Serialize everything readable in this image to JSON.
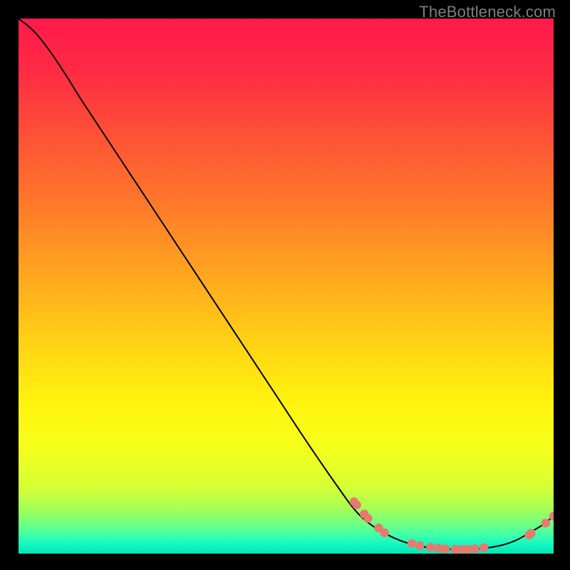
{
  "watermark": "TheBottleneck.com",
  "colors": {
    "line": "#000000",
    "dot": "#e77a6f",
    "background_black": "#000000"
  },
  "chart_data": {
    "type": "line",
    "title": "",
    "xlabel": "",
    "ylabel": "",
    "xlim": [
      0,
      100
    ],
    "ylim": [
      0,
      100
    ],
    "annotations": [],
    "curve": [
      {
        "x": 0.0,
        "y": 100.0
      },
      {
        "x": 3.0,
        "y": 97.5
      },
      {
        "x": 6.0,
        "y": 93.7
      },
      {
        "x": 9.0,
        "y": 89.2
      },
      {
        "x": 12.0,
        "y": 84.4
      },
      {
        "x": 18.0,
        "y": 75.3
      },
      {
        "x": 24.0,
        "y": 66.2
      },
      {
        "x": 30.0,
        "y": 57.1
      },
      {
        "x": 36.0,
        "y": 48.0
      },
      {
        "x": 42.0,
        "y": 38.9
      },
      {
        "x": 48.0,
        "y": 29.8
      },
      {
        "x": 54.0,
        "y": 20.7
      },
      {
        "x": 60.0,
        "y": 12.0
      },
      {
        "x": 63.0,
        "y": 8.0
      },
      {
        "x": 66.0,
        "y": 5.3
      },
      {
        "x": 70.0,
        "y": 3.0
      },
      {
        "x": 74.0,
        "y": 1.6
      },
      {
        "x": 78.0,
        "y": 1.0
      },
      {
        "x": 82.0,
        "y": 0.8
      },
      {
        "x": 86.0,
        "y": 0.9
      },
      {
        "x": 90.0,
        "y": 1.5
      },
      {
        "x": 93.0,
        "y": 2.5
      },
      {
        "x": 96.0,
        "y": 4.2
      },
      {
        "x": 98.0,
        "y": 5.4
      },
      {
        "x": 100.0,
        "y": 7.0
      }
    ],
    "points": [
      {
        "x": 62.7,
        "y": 9.7
      },
      {
        "x": 63.2,
        "y": 9.1
      },
      {
        "x": 64.6,
        "y": 7.4
      },
      {
        "x": 65.3,
        "y": 6.6
      },
      {
        "x": 67.3,
        "y": 4.8
      },
      {
        "x": 68.4,
        "y": 3.9
      },
      {
        "x": 73.5,
        "y": 1.9
      },
      {
        "x": 75.0,
        "y": 1.5
      },
      {
        "x": 77.0,
        "y": 1.2
      },
      {
        "x": 78.5,
        "y": 1.0
      },
      {
        "x": 79.8,
        "y": 0.9
      },
      {
        "x": 81.6,
        "y": 0.8
      },
      {
        "x": 82.0,
        "y": 0.8
      },
      {
        "x": 83.2,
        "y": 0.8
      },
      {
        "x": 84.0,
        "y": 0.8
      },
      {
        "x": 85.3,
        "y": 0.9
      },
      {
        "x": 87.0,
        "y": 1.1
      },
      {
        "x": 95.4,
        "y": 3.5
      },
      {
        "x": 95.8,
        "y": 3.8
      },
      {
        "x": 98.5,
        "y": 5.7
      },
      {
        "x": 100.0,
        "y": 7.0
      }
    ],
    "gradient_stops": [
      {
        "offset": 0.0,
        "color": "#ff1a4b"
      },
      {
        "offset": 0.1,
        "color": "#ff2b44"
      },
      {
        "offset": 0.22,
        "color": "#ff5236"
      },
      {
        "offset": 0.35,
        "color": "#ff7a2a"
      },
      {
        "offset": 0.48,
        "color": "#ffa61f"
      },
      {
        "offset": 0.6,
        "color": "#ffd015"
      },
      {
        "offset": 0.72,
        "color": "#fff40e"
      },
      {
        "offset": 0.8,
        "color": "#f6ff1a"
      },
      {
        "offset": 0.875,
        "color": "#d6ff33"
      },
      {
        "offset": 0.915,
        "color": "#a7ff55"
      },
      {
        "offset": 0.945,
        "color": "#6fff82"
      },
      {
        "offset": 0.965,
        "color": "#3fffaa"
      },
      {
        "offset": 0.982,
        "color": "#16f7c2"
      },
      {
        "offset": 1.0,
        "color": "#00e7b2"
      }
    ]
  }
}
